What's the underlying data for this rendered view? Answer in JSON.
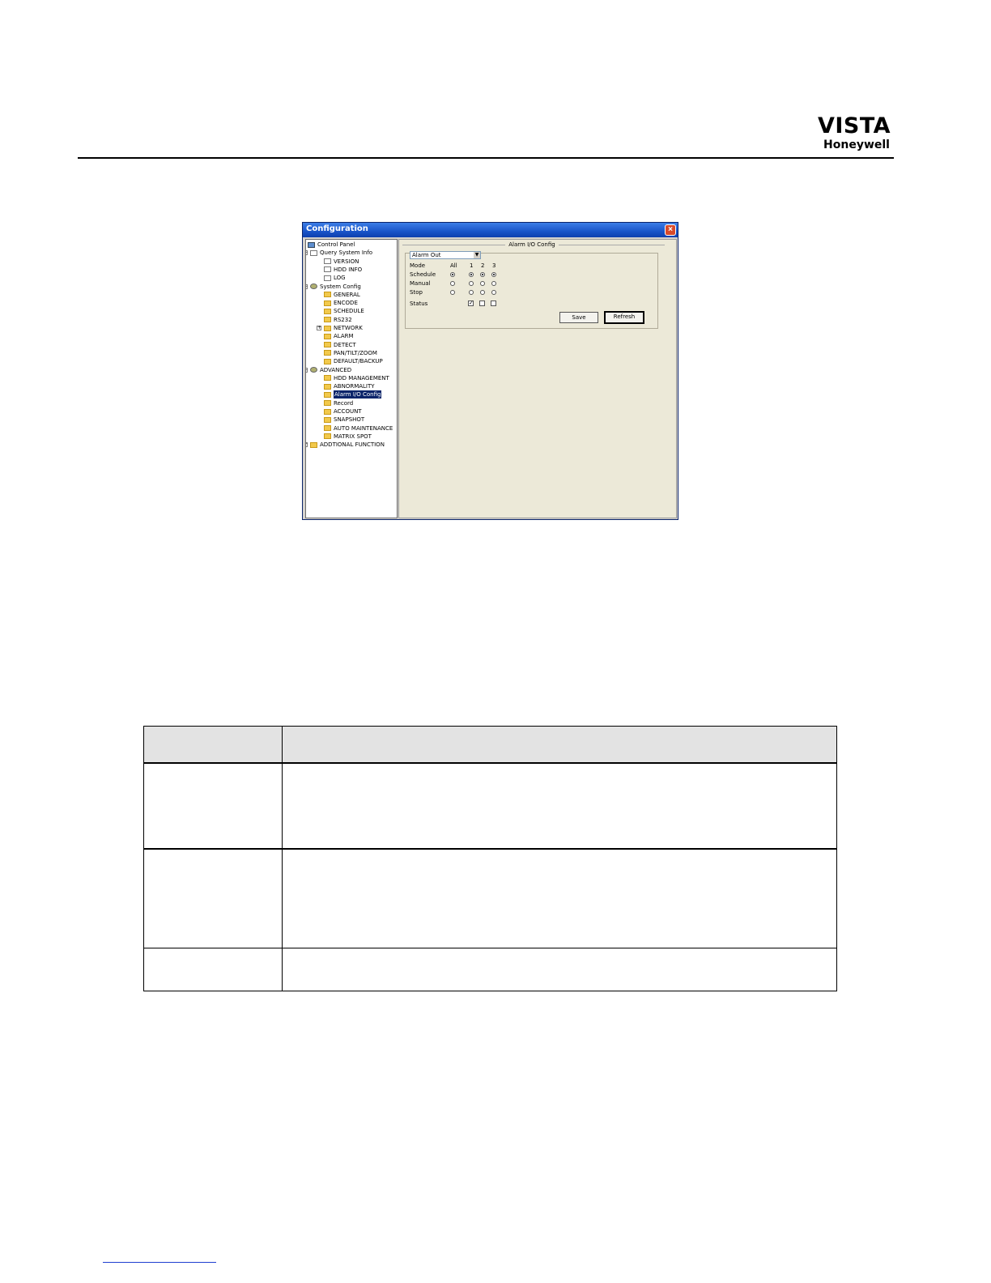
{
  "header": {
    "brand": "VISTA",
    "company": "Honeywell"
  },
  "window": {
    "title": "Configuration",
    "close_glyph": "×",
    "tree": [
      {
        "label": "Control Panel",
        "icon": "panel",
        "level": 0
      },
      {
        "label": "Query System Info",
        "icon": "doc",
        "level": 1,
        "expander": "−"
      },
      {
        "label": "VERSION",
        "icon": "doc",
        "level": 2
      },
      {
        "label": "HDD INFO",
        "icon": "doc",
        "level": 2
      },
      {
        "label": "LOG",
        "icon": "doc",
        "level": 2
      },
      {
        "label": "System Config",
        "icon": "gear",
        "level": 1,
        "expander": "−"
      },
      {
        "label": "GENERAL",
        "icon": "folder",
        "level": 2
      },
      {
        "label": "ENCODE",
        "icon": "folder",
        "level": 2
      },
      {
        "label": "SCHEDULE",
        "icon": "folder",
        "level": 2
      },
      {
        "label": "RS232",
        "icon": "folder",
        "level": 2
      },
      {
        "label": "NETWORK",
        "icon": "folder",
        "level": 2,
        "expander": "+"
      },
      {
        "label": "ALARM",
        "icon": "folder",
        "level": 2
      },
      {
        "label": "DETECT",
        "icon": "folder",
        "level": 2
      },
      {
        "label": "PAN/TILT/ZOOM",
        "icon": "folder",
        "level": 2
      },
      {
        "label": "DEFAULT/BACKUP",
        "icon": "folder",
        "level": 2
      },
      {
        "label": "ADVANCED",
        "icon": "gear",
        "level": 1,
        "expander": "−"
      },
      {
        "label": "HDD MANAGEMENT",
        "icon": "folder",
        "level": 2
      },
      {
        "label": "ABNORMALITY",
        "icon": "folder",
        "level": 2
      },
      {
        "label": "Alarm I/O Config",
        "icon": "folder",
        "level": 2,
        "selected": true
      },
      {
        "label": "Record",
        "icon": "folder",
        "level": 2
      },
      {
        "label": "ACCOUNT",
        "icon": "folder",
        "level": 2
      },
      {
        "label": "SNAPSHOT",
        "icon": "folder",
        "level": 2
      },
      {
        "label": "AUTO MAINTENANCE",
        "icon": "folder",
        "level": 2
      },
      {
        "label": "MATRIX SPOT",
        "icon": "folder",
        "level": 2
      },
      {
        "label": "ADDTIONAL FUNCTION",
        "icon": "folder",
        "level": 1,
        "expander": "+"
      }
    ],
    "panel": {
      "title": "Alarm I/O Config",
      "dropdown_value": "Alarm Out",
      "dropdown_arrow": "▼",
      "mode_label": "Mode",
      "columns": [
        "All",
        "1",
        "2",
        "3"
      ],
      "rows": [
        {
          "label": "Schedule",
          "selected": [
            true,
            true,
            true,
            true
          ]
        },
        {
          "label": "Manual",
          "selected": [
            false,
            false,
            false,
            false
          ]
        },
        {
          "label": "Stop",
          "selected": [
            false,
            false,
            false,
            false
          ]
        }
      ],
      "status_label": "Status",
      "status_checks": [
        true,
        false,
        false
      ],
      "check_glyph": "✓",
      "save_label": "Save",
      "refresh_label": "Refresh"
    }
  },
  "table": {
    "header": [
      "",
      ""
    ],
    "rows": [
      [
        "",
        ""
      ],
      [
        "",
        ""
      ],
      [
        "",
        ""
      ]
    ]
  }
}
